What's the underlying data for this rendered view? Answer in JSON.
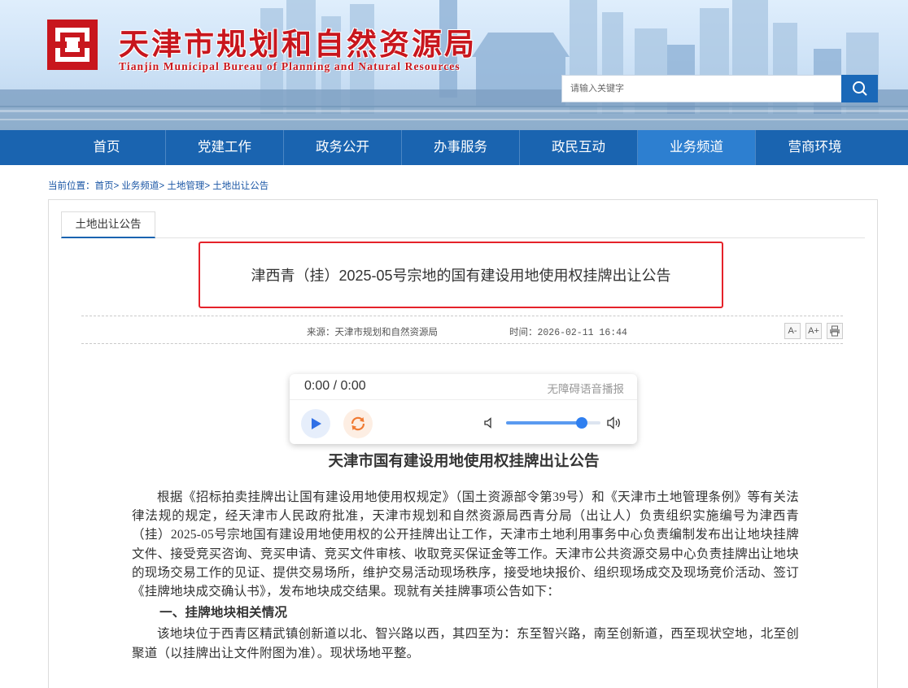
{
  "header": {
    "title": "天津市规划和自然资源局",
    "subtitle": "Tianjin Municipal Bureau of Planning and Natural Resources",
    "search": {
      "placeholder": "请输入关键字"
    },
    "brand_color": "#c8161d"
  },
  "nav": {
    "items": [
      {
        "label": "首页",
        "active": false
      },
      {
        "label": "党建工作",
        "active": false
      },
      {
        "label": "政务公开",
        "active": false
      },
      {
        "label": "办事服务",
        "active": false
      },
      {
        "label": "政民互动",
        "active": false
      },
      {
        "label": "业务频道",
        "active": true
      },
      {
        "label": "营商环境",
        "active": false
      }
    ],
    "color": "#1a64b0",
    "active_color": "#2d7fd0"
  },
  "breadcrumb": {
    "prefix": "当前位置：",
    "items": [
      "首页",
      "业务频道",
      "土地管理",
      "土地出让公告"
    ],
    "separator": ">"
  },
  "section": {
    "tab_label": "土地出让公告"
  },
  "article": {
    "title": "津西青（挂）2025-05号宗地的国有建设用地使用权挂牌出让公告",
    "source_label": "来源：天津市规划和自然资源局",
    "time_label": "时间：2026-02-11 16:44",
    "tools": {
      "font_smaller": "A-",
      "font_larger": "A+"
    }
  },
  "player": {
    "time": "0:00 / 0:00",
    "label": "无障碍语音播报",
    "volume": 0.8
  },
  "document": {
    "heading": "天津市国有建设用地使用权挂牌出让公告",
    "paragraph1": "根据《招标拍卖挂牌出让国有建设用地使用权规定》（国土资源部令第39号）和《天津市土地管理条例》等有关法律法规的规定，经天津市人民政府批准，天津市规划和自然资源局西青分局（出让人）负责组织实施编号为津西青（挂）2025-05号宗地国有建设用地使用权的公开挂牌出让工作，天津市土地利用事务中心负责编制发布出让地块挂牌文件、接受竞买咨询、竞买申请、竞买文件审核、收取竞买保证金等工作。天津市公共资源交易中心负责挂牌出让地块的现场交易工作的见证、提供交易场所，维护交易活动现场秩序，接受地块报价、组织现场成交及现场竞价活动、签订《挂牌地块成交确认书》，发布地块成交结果。现就有关挂牌事项公告如下：",
    "section1_heading": "一、挂牌地块相关情况",
    "paragraph2": "该地块位于西青区精武镇创新道以北、智兴路以西，其四至为：东至智兴路，南至创新道，西至现状空地，北至创聚道（以挂牌出让文件附图为准）。现状场地平整。"
  }
}
